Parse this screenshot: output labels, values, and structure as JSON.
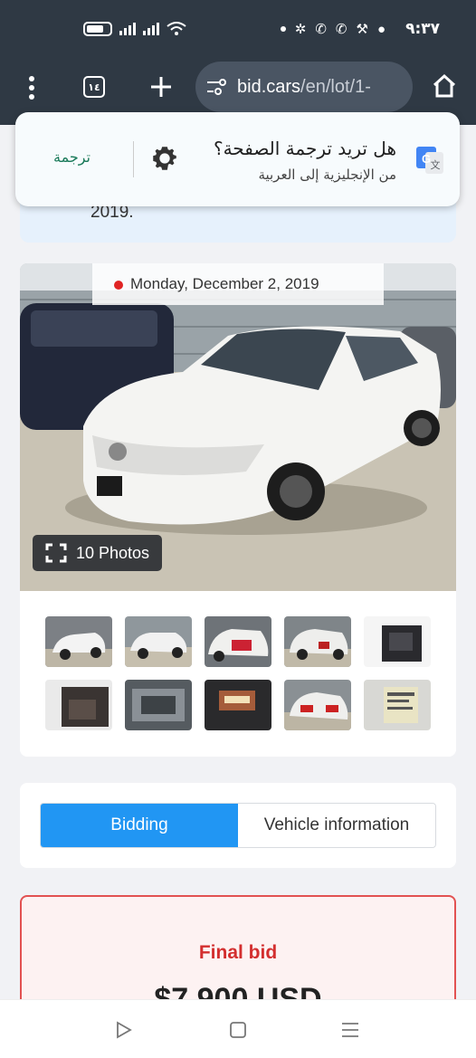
{
  "status_bar": {
    "time": "٩:٣٧"
  },
  "toolbar": {
    "tab_count": "١٤",
    "url_host": "bid.cars",
    "url_path": "/en/lot/1-"
  },
  "page": {
    "partial_text": "2019."
  },
  "translate_bar": {
    "question": "هل تريد ترجمة الصفحة؟",
    "subtitle": "من الإنجليزية إلى العربية",
    "action": "ترجمة"
  },
  "gallery": {
    "date": "Monday, December 2, 2019",
    "photos_label": "10 Photos",
    "thumbnails": [
      "front-left",
      "front-right",
      "rear-damage",
      "rear-left",
      "interior-front",
      "interior-rear",
      "engine",
      "dashboard",
      "rear",
      "vin-label"
    ]
  },
  "tabs": [
    {
      "label": "Bidding",
      "active": true
    },
    {
      "label": "Vehicle information",
      "active": false
    }
  ],
  "bid": {
    "label": "Final bid",
    "amount": "$7,900 USD"
  },
  "colors": {
    "accent": "#2196f3",
    "bid_red": "#d32f2f",
    "status_bg": "#2f3944"
  }
}
